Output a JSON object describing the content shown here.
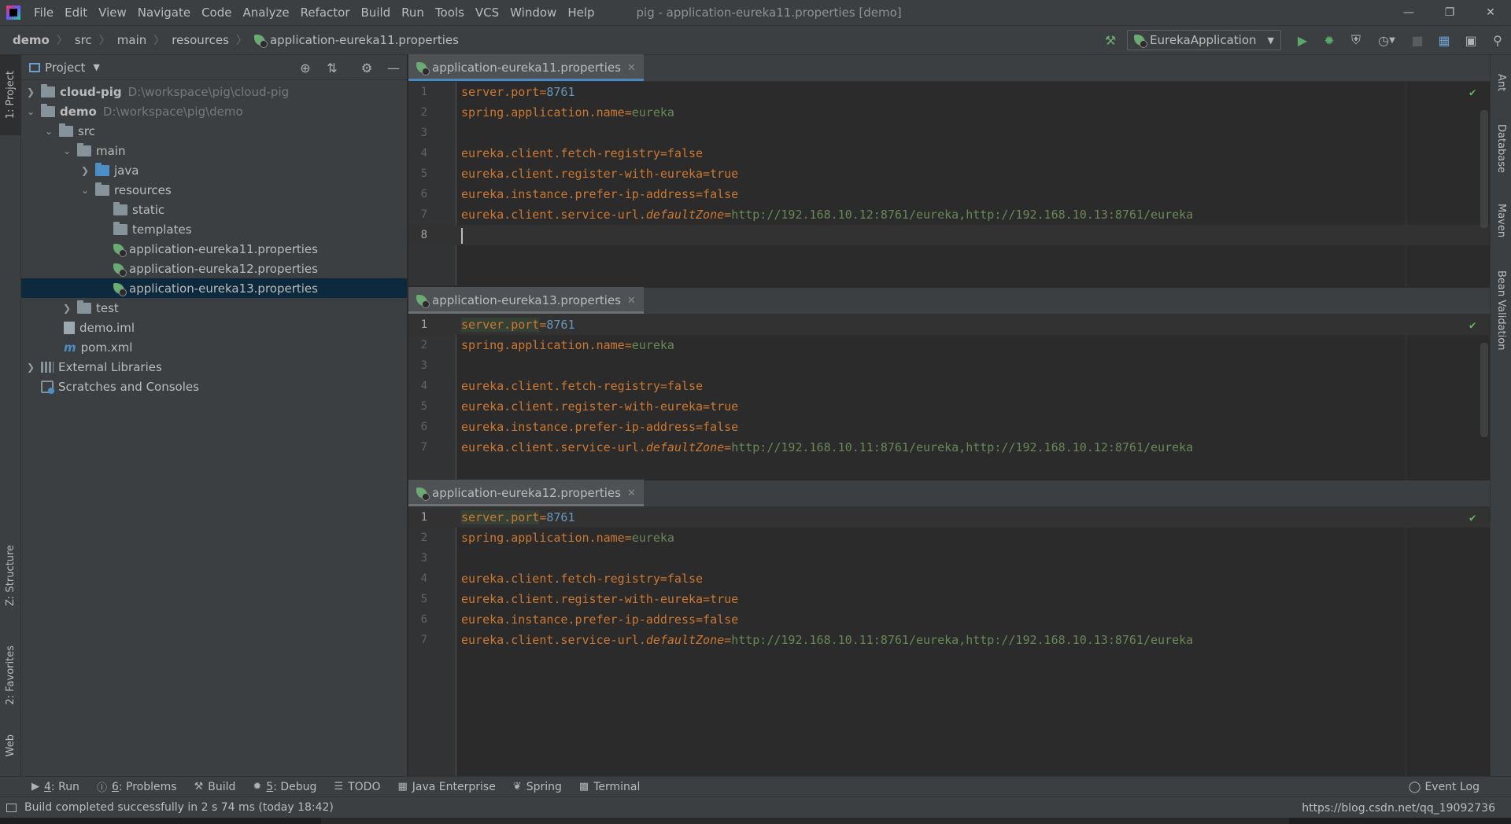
{
  "menu": {
    "items": [
      "File",
      "Edit",
      "View",
      "Navigate",
      "Code",
      "Analyze",
      "Refactor",
      "Build",
      "Run",
      "Tools",
      "VCS",
      "Window",
      "Help"
    ],
    "window_title": "pig - application-eureka11.properties [demo]"
  },
  "breadcrumb": [
    "demo",
    "src",
    "main",
    "resources",
    "application-eureka11.properties"
  ],
  "run_config": "EurekaApplication",
  "project": {
    "title": "Project",
    "tree": [
      {
        "label": "cloud-pig",
        "path": "D:\\workspace\\pig\\cloud-pig"
      },
      {
        "label": "demo",
        "path": "D:\\workspace\\pig\\demo"
      },
      {
        "label": "src"
      },
      {
        "label": "main"
      },
      {
        "label": "java"
      },
      {
        "label": "resources"
      },
      {
        "label": "static"
      },
      {
        "label": "templates"
      },
      {
        "label": "application-eureka11.properties"
      },
      {
        "label": "application-eureka12.properties"
      },
      {
        "label": "application-eureka13.properties"
      },
      {
        "label": "test"
      },
      {
        "label": "demo.iml"
      },
      {
        "label": "pom.xml"
      },
      {
        "label": "External Libraries"
      },
      {
        "label": "Scratches and Consoles"
      }
    ]
  },
  "left_tabs": {
    "project": "1: Project",
    "structure": "Z: Structure",
    "favorites": "2: Favorites",
    "web": "Web"
  },
  "right_tabs": {
    "ant": "Ant",
    "database": "Database",
    "maven": "Maven",
    "bean": "Bean Validation"
  },
  "editors": [
    {
      "tab": "application-eureka11.properties",
      "lines": [
        {
          "n": "1",
          "key": "server.port",
          "val": "8761"
        },
        {
          "n": "2",
          "key": "spring.application.name",
          "val": "eureka"
        },
        {
          "n": "3",
          "key": "",
          "val": ""
        },
        {
          "n": "4",
          "key": "eureka.client.fetch-registry",
          "val": "false"
        },
        {
          "n": "5",
          "key": "eureka.client.register-with-eureka",
          "val": "true"
        },
        {
          "n": "6",
          "key": "eureka.instance.prefer-ip-address",
          "val": "false"
        },
        {
          "n": "7",
          "key": "eureka.client.service-url.",
          "key_italic": "defaultZone",
          "val": "http://192.168.10.12:8761/eureka,http://192.168.10.13:8761/eureka"
        },
        {
          "n": "8",
          "key": "",
          "val": ""
        }
      ]
    },
    {
      "tab": "application-eureka13.properties",
      "lines": [
        {
          "n": "1",
          "key": "server.port",
          "val": "8761"
        },
        {
          "n": "2",
          "key": "spring.application.name",
          "val": "eureka"
        },
        {
          "n": "3",
          "key": "",
          "val": ""
        },
        {
          "n": "4",
          "key": "eureka.client.fetch-registry",
          "val": "false"
        },
        {
          "n": "5",
          "key": "eureka.client.register-with-eureka",
          "val": "true"
        },
        {
          "n": "6",
          "key": "eureka.instance.prefer-ip-address",
          "val": "false"
        },
        {
          "n": "7",
          "key": "eureka.client.service-url.",
          "key_italic": "defaultZone",
          "val": "http://192.168.10.11:8761/eureka,http://192.168.10.12:8761/eureka"
        }
      ]
    },
    {
      "tab": "application-eureka12.properties",
      "lines": [
        {
          "n": "1",
          "key": "server.port",
          "val": "8761"
        },
        {
          "n": "2",
          "key": "spring.application.name",
          "val": "eureka"
        },
        {
          "n": "3",
          "key": "",
          "val": ""
        },
        {
          "n": "4",
          "key": "eureka.client.fetch-registry",
          "val": "false"
        },
        {
          "n": "5",
          "key": "eureka.client.register-with-eureka",
          "val": "true"
        },
        {
          "n": "6",
          "key": "eureka.instance.prefer-ip-address",
          "val": "false"
        },
        {
          "n": "7",
          "key": "eureka.client.service-url.",
          "key_italic": "defaultZone",
          "val": "http://192.168.10.11:8761/eureka,http://192.168.10.13:8761/eureka"
        }
      ]
    }
  ],
  "bottom_tools": {
    "run_num": "4",
    "run": ": Run",
    "problems_num": "6",
    "problems": ": Problems",
    "build": "Build",
    "debug_num": "5",
    "debug": ": Debug",
    "todo": "TODO",
    "java_enterprise": "Java Enterprise",
    "spring": "Spring",
    "terminal": "Terminal",
    "event_log": "Event Log"
  },
  "status": {
    "message": "Build completed successfully in 2 s 74 ms (today 18:42)",
    "watermark": "https://blog.csdn.net/qq_19092736"
  },
  "colors": {
    "accent": "#4a88c7",
    "key": "#cc7832",
    "number": "#6897bb",
    "string": "#6a8759",
    "selection": "#0d293e"
  }
}
